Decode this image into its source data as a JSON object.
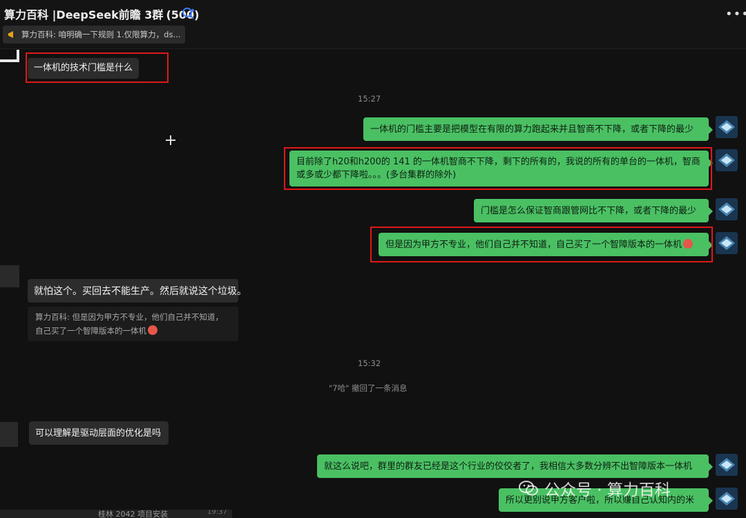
{
  "header": {
    "title": "算力百科 |DeepSeek前瞻 3群",
    "member_count": "(500)",
    "search_icon": "search-people-icon",
    "more_icon": "more-dots-icon"
  },
  "pinned": {
    "text": "算力百科: 咱明确一下规则 1.仅限算力，ds..."
  },
  "messages": [
    {
      "side": "left",
      "text": "一体机的技术门槛是什么"
    },
    {
      "type": "time",
      "text": "15:27"
    },
    {
      "side": "right",
      "text": "一体机的门槛主要是把模型在有限的算力跑起来并且智商不下降，或者下降的最少"
    },
    {
      "side": "right",
      "text": "目前除了h20和h200的 141 的一体机智商不下降，剩下的所有的，我说的所有的单台的一体机，智商或多或少都下降啦。。。(多台集群的除外)"
    },
    {
      "side": "right",
      "text": "门槛是怎么保证智商跟管网比不下降，或者下降的最少"
    },
    {
      "side": "right",
      "text": "但是因为甲方不专业，他们自己并不知道，自己买了一个智障版本的一体机"
    },
    {
      "side": "left",
      "text": "就怕这个。买回去不能生产。然后就说这个垃圾。",
      "quote": "算力百科: 但是因为甲方不专业，他们自己并不知道，自己买了一个智障版本的一体机"
    },
    {
      "type": "time",
      "text": "15:32"
    },
    {
      "type": "system",
      "text": "\"7哈\" 撤回了一条消息"
    },
    {
      "side": "left",
      "text": "可以理解是驱动层面的优化是吗"
    },
    {
      "side": "right",
      "text": "就这么说吧，群里的群友已经是这个行业的佼佼者了，我相信大多数分辨不出智障版本一体机"
    },
    {
      "side": "right",
      "text": "所以更别说甲方客户啦，所以赚自己认知内的米"
    }
  ],
  "watermark": {
    "text": "公众号 · 算力百科"
  },
  "bottom": {
    "text": "桂林 2042 项目安装",
    "time": "19:37"
  },
  "colors": {
    "bubble_right": "#4ac063",
    "bubble_left": "#2c2c2c",
    "highlight": "#e01818",
    "background": "#111111"
  }
}
